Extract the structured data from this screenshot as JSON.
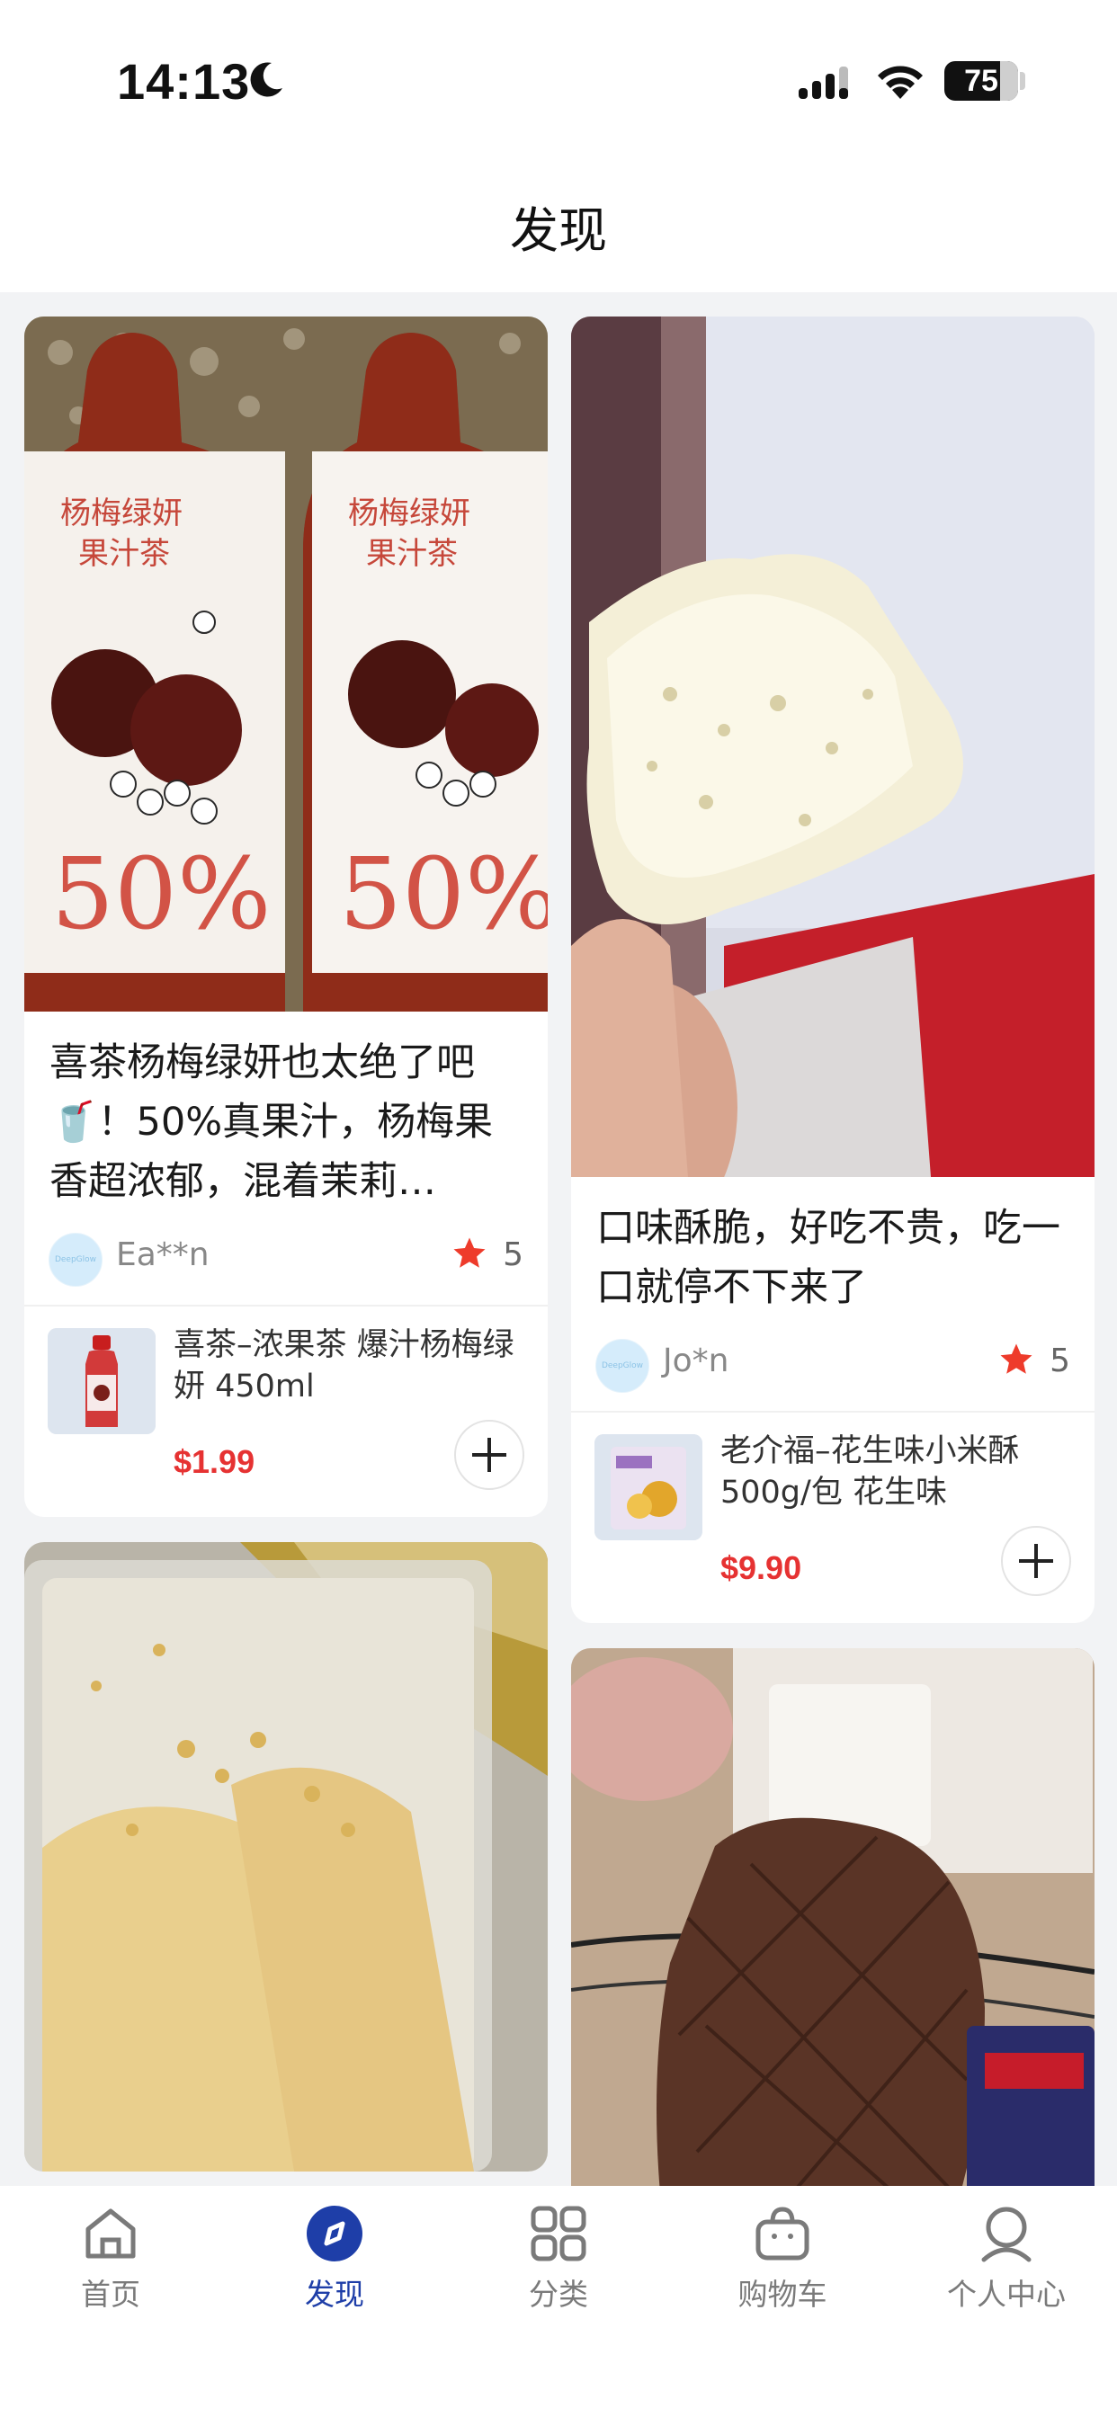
{
  "status_bar": {
    "time": "14:13",
    "battery": "75"
  },
  "header": {
    "title": "发现"
  },
  "feed": {
    "left": [
      {
        "title": "喜茶杨梅绿妍也太绝了吧🥤！50%真果汁，杨梅果香超浓郁，混着茉莉…",
        "author": "Ea**n",
        "likes": "5",
        "product_name": "喜茶–浓果茶 爆汁杨梅绿妍 450ml",
        "price": "$1.99"
      }
    ],
    "right": [
      {
        "title": "口味酥脆，好吃不贵，吃一口就停不下来了",
        "author": "Jo*n",
        "likes": "5",
        "product_name": "老介福–花生味小米酥500g/包 花生味",
        "price": "$9.90"
      }
    ]
  },
  "tabbar": {
    "items": [
      {
        "label": "首页",
        "icon": "home-icon"
      },
      {
        "label": "发现",
        "icon": "compass-icon"
      },
      {
        "label": "分类",
        "icon": "grid-icon"
      },
      {
        "label": "购物车",
        "icon": "bag-icon"
      },
      {
        "label": "个人中心",
        "icon": "user-icon"
      }
    ],
    "active": "发现",
    "active_color": "#1e3ea8"
  },
  "colors": {
    "price": "#e63232",
    "star": "#ee3b2b",
    "avatar": "#d5ecfb"
  }
}
